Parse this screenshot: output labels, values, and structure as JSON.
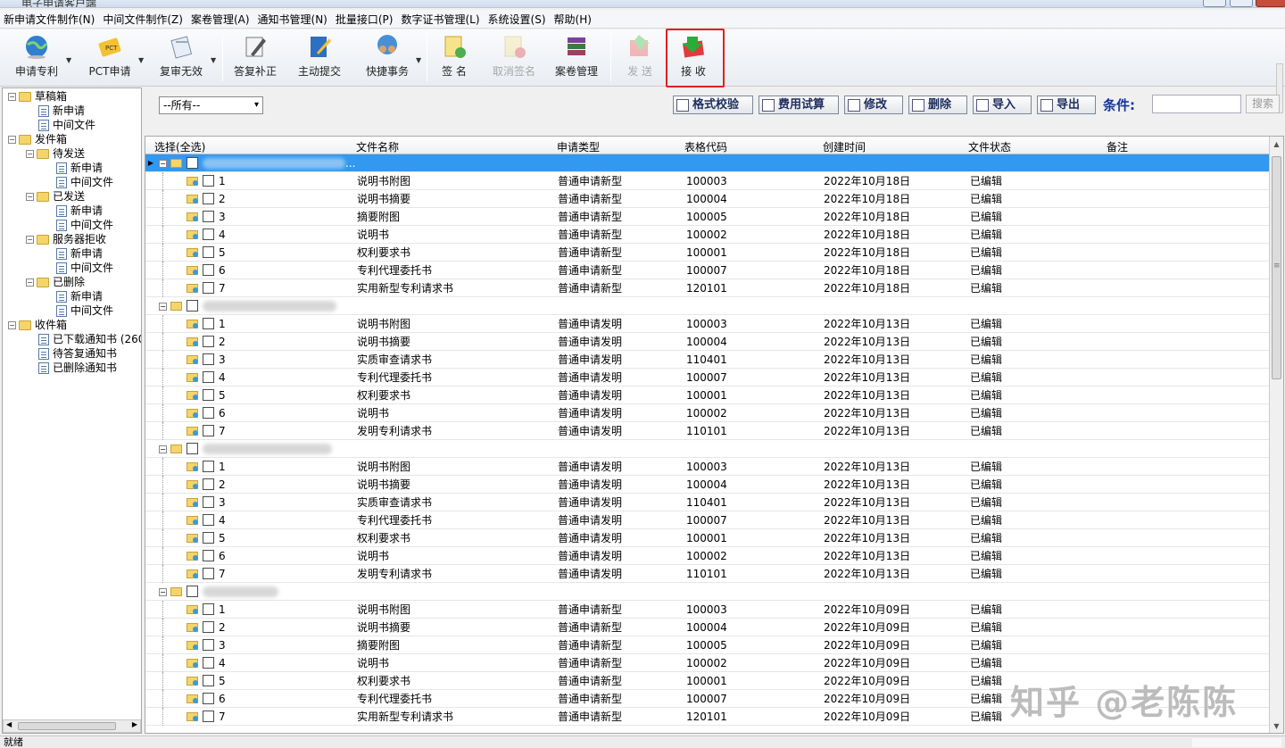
{
  "window": {
    "title": "电子申请客户端"
  },
  "menu": [
    "新申请文件制作(N)",
    "中间文件制作(Z)",
    "案卷管理(A)",
    "通知书管理(N)",
    "批量接口(P)",
    "数字证书管理(L)",
    "系统设置(S)",
    "帮助(H)"
  ],
  "toolbar": {
    "apply": "申请专利",
    "pct": "PCT申请",
    "reexam": "复审无效",
    "reply": "答复补正",
    "submit": "主动提交",
    "quick": "快捷事务",
    "sign": "签 名",
    "unsign": "取消签名",
    "archive": "案卷管理",
    "send": "发 送",
    "receive": "接 收"
  },
  "tree": {
    "drafts": "草稿箱",
    "drafts_new": "新申请",
    "drafts_mid": "中间文件",
    "outbox": "发件箱",
    "pending": "待发送",
    "pending_new": "新申请",
    "pending_mid": "中间文件",
    "sent": "已发送",
    "sent_new": "新申请",
    "sent_mid": "中间文件",
    "rejected": "服务器拒收",
    "rejected_new": "新申请",
    "rejected_mid": "中间文件",
    "deleted": "已删除",
    "deleted_new": "新申请",
    "deleted_mid": "中间文件",
    "inbox": "收件箱",
    "downloaded": "已下载通知书 (260",
    "to_reply": "待答复通知书",
    "deleted_notice": "已删除通知书"
  },
  "filter": {
    "select_value": "--所有--",
    "check_format": "格式校验",
    "fee_calc": "费用试算",
    "modify": "修改",
    "delete": "删除",
    "import": "导入",
    "export": "导出",
    "condition_label": "条件:",
    "search": "搜索"
  },
  "grid": {
    "headers": {
      "select": "选择(全选)",
      "name": "文件名称",
      "type": "申请类型",
      "code": "表格代码",
      "created": "创建时间",
      "status": "文件状态",
      "note": "备注"
    },
    "groups": [
      {
        "selected": true,
        "trailing": "...",
        "rows": [
          {
            "idx": "1",
            "name": "说明书附图",
            "type": "普通申请新型",
            "code": "100003",
            "date": "2022年10月18日",
            "status": "已编辑"
          },
          {
            "idx": "2",
            "name": "说明书摘要",
            "type": "普通申请新型",
            "code": "100004",
            "date": "2022年10月18日",
            "status": "已编辑"
          },
          {
            "idx": "3",
            "name": "摘要附图",
            "type": "普通申请新型",
            "code": "100005",
            "date": "2022年10月18日",
            "status": "已编辑"
          },
          {
            "idx": "4",
            "name": "说明书",
            "type": "普通申请新型",
            "code": "100002",
            "date": "2022年10月18日",
            "status": "已编辑"
          },
          {
            "idx": "5",
            "name": "权利要求书",
            "type": "普通申请新型",
            "code": "100001",
            "date": "2022年10月18日",
            "status": "已编辑"
          },
          {
            "idx": "6",
            "name": "专利代理委托书",
            "type": "普通申请新型",
            "code": "100007",
            "date": "2022年10月18日",
            "status": "已编辑"
          },
          {
            "idx": "7",
            "name": "实用新型专利请求书",
            "type": "普通申请新型",
            "code": "120101",
            "date": "2022年10月18日",
            "status": "已编辑"
          }
        ]
      },
      {
        "selected": false,
        "trailing": "",
        "rows": [
          {
            "idx": "1",
            "name": "说明书附图",
            "type": "普通申请发明",
            "code": "100003",
            "date": "2022年10月13日",
            "status": "已编辑"
          },
          {
            "idx": "2",
            "name": "说明书摘要",
            "type": "普通申请发明",
            "code": "100004",
            "date": "2022年10月13日",
            "status": "已编辑"
          },
          {
            "idx": "3",
            "name": "实质审查请求书",
            "type": "普通申请发明",
            "code": "110401",
            "date": "2022年10月13日",
            "status": "已编辑"
          },
          {
            "idx": "4",
            "name": "专利代理委托书",
            "type": "普通申请发明",
            "code": "100007",
            "date": "2022年10月13日",
            "status": "已编辑"
          },
          {
            "idx": "5",
            "name": "权利要求书",
            "type": "普通申请发明",
            "code": "100001",
            "date": "2022年10月13日",
            "status": "已编辑"
          },
          {
            "idx": "6",
            "name": "说明书",
            "type": "普通申请发明",
            "code": "100002",
            "date": "2022年10月13日",
            "status": "已编辑"
          },
          {
            "idx": "7",
            "name": "发明专利请求书",
            "type": "普通申请发明",
            "code": "110101",
            "date": "2022年10月13日",
            "status": "已编辑"
          }
        ]
      },
      {
        "selected": false,
        "trailing": "",
        "rows": [
          {
            "idx": "1",
            "name": "说明书附图",
            "type": "普通申请发明",
            "code": "100003",
            "date": "2022年10月13日",
            "status": "已编辑"
          },
          {
            "idx": "2",
            "name": "说明书摘要",
            "type": "普通申请发明",
            "code": "100004",
            "date": "2022年10月13日",
            "status": "已编辑"
          },
          {
            "idx": "3",
            "name": "实质审查请求书",
            "type": "普通申请发明",
            "code": "110401",
            "date": "2022年10月13日",
            "status": "已编辑"
          },
          {
            "idx": "4",
            "name": "专利代理委托书",
            "type": "普通申请发明",
            "code": "100007",
            "date": "2022年10月13日",
            "status": "已编辑"
          },
          {
            "idx": "5",
            "name": "权利要求书",
            "type": "普通申请发明",
            "code": "100001",
            "date": "2022年10月13日",
            "status": "已编辑"
          },
          {
            "idx": "6",
            "name": "说明书",
            "type": "普通申请发明",
            "code": "100002",
            "date": "2022年10月13日",
            "status": "已编辑"
          },
          {
            "idx": "7",
            "name": "发明专利请求书",
            "type": "普通申请发明",
            "code": "110101",
            "date": "2022年10月13日",
            "status": "已编辑"
          }
        ]
      },
      {
        "selected": false,
        "trailing": "",
        "rows": [
          {
            "idx": "1",
            "name": "说明书附图",
            "type": "普通申请新型",
            "code": "100003",
            "date": "2022年10月09日",
            "status": "已编辑"
          },
          {
            "idx": "2",
            "name": "说明书摘要",
            "type": "普通申请新型",
            "code": "100004",
            "date": "2022年10月09日",
            "status": "已编辑"
          },
          {
            "idx": "3",
            "name": "摘要附图",
            "type": "普通申请新型",
            "code": "100005",
            "date": "2022年10月09日",
            "status": "已编辑"
          },
          {
            "idx": "4",
            "name": "说明书",
            "type": "普通申请新型",
            "code": "100002",
            "date": "2022年10月09日",
            "status": "已编辑"
          },
          {
            "idx": "5",
            "name": "权利要求书",
            "type": "普通申请新型",
            "code": "100001",
            "date": "2022年10月09日",
            "status": "已编辑"
          },
          {
            "idx": "6",
            "name": "专利代理委托书",
            "type": "普通申请新型",
            "code": "100007",
            "date": "2022年10月09日",
            "status": "已编辑"
          },
          {
            "idx": "7",
            "name": "实用新型专利请求书",
            "type": "普通申请新型",
            "code": "120101",
            "date": "2022年10月09日",
            "status": "已编辑"
          }
        ]
      }
    ]
  },
  "watermark": "知乎 @老陈陈",
  "status": {
    "text": "就绪"
  },
  "colors": {
    "selection": "#3298f0",
    "highlight_border": "#e02020",
    "action_text": "#1d2d5e"
  }
}
